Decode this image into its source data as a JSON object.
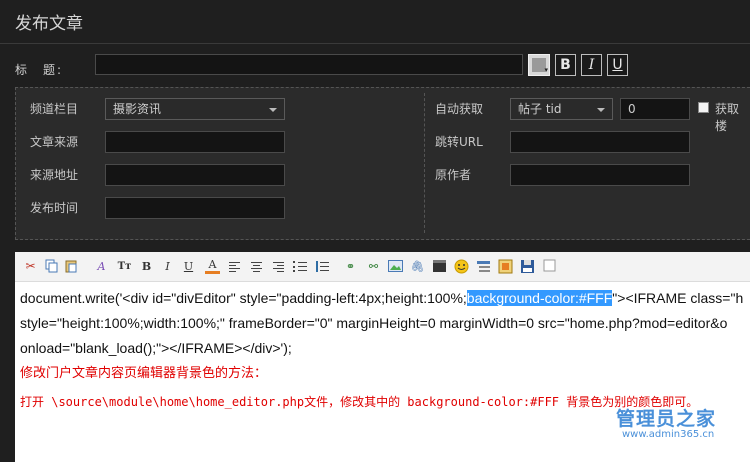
{
  "page": {
    "title": "发布文章"
  },
  "title_row": {
    "label": "标　题:",
    "value": "",
    "bold_label": "B",
    "italic_label": "I",
    "underline_label": "U"
  },
  "meta": {
    "channel_label": "频道栏目",
    "channel_value": "摄影资讯",
    "source_label": "文章来源",
    "source_url_label": "来源地址",
    "publish_time_label": "发布时间",
    "auto_fetch_label": "自动获取",
    "auto_fetch_value": "帖子 tid",
    "auto_fetch_number": "0",
    "fetch_floor_label": "获取楼",
    "redirect_label": "跳转URL",
    "author_label": "原作者"
  },
  "editor": {
    "line1_before": "document.write('<div id=\"divEditor\" style=\"padding-left:4px;height:100%;",
    "line1_highlight": "background-color:#FFF",
    "line1_after": "\"><IFRAME class=\"h",
    "line2": "style=\"height:100%;width:100%;\" frameBorder=\"0\" marginHeight=0 marginWidth=0 src=\"home.php?mod=editor&o",
    "line3": "onload=\"blank_load();\"></IFRAME></div>');",
    "red_heading": "修改门户文章内容页编辑器背景色的方法：",
    "red_body": "打开 \\source\\module\\home\\home_editor.php文件，修改其中的 background-color:#FFF  背景色为别的颜色即可。"
  },
  "watermark": {
    "name": "管理员之家",
    "url": "www.admin365.cn"
  },
  "colors": {
    "accent_blue": "#3399ff",
    "highlight_red": "#e00000",
    "panel_bg": "#2b2b2b",
    "page_bg": "#1f1f1f"
  },
  "toolbar_icons": [
    "cut-icon",
    "copy-icon",
    "paste-icon",
    "font-family-icon",
    "font-size-icon",
    "bold-icon",
    "italic-icon",
    "underline-icon",
    "font-color-icon",
    "align-left-icon",
    "align-center-icon",
    "align-right-icon",
    "ordered-list-icon",
    "unordered-list-icon",
    "link-icon",
    "unlink-icon",
    "image-icon",
    "attachment-icon",
    "video-icon",
    "emoticon-icon",
    "quote-icon",
    "insert-icon",
    "save-icon",
    "source-checkbox-icon"
  ]
}
